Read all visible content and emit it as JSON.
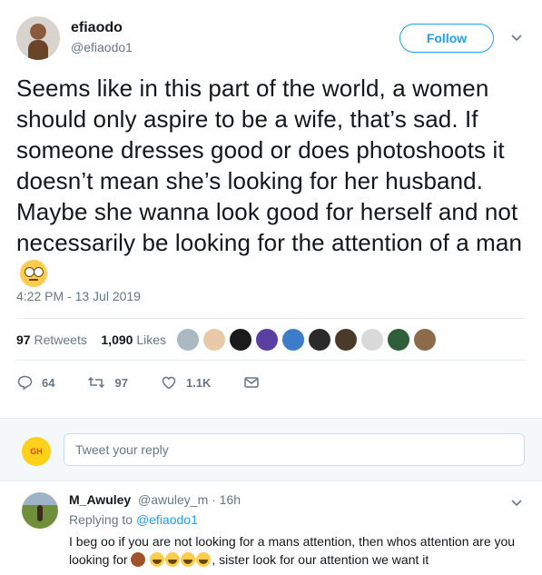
{
  "tweet": {
    "author_name": "efiaodo",
    "author_handle": "@efiaodo1",
    "follow_label": "Follow",
    "text": "Seems like in this part of the world, a women should only aspire to be a wife, that’s sad. If someone dresses good or does photoshoots it doesn’t mean she’s looking for her husband. Maybe she wanna look good for herself and not necessarily be looking for the attention of a man",
    "trailing_emoji": "face-with-rolling-eyes-emoji",
    "timestamp": "4:22 PM - 13 Jul 2019",
    "stats": {
      "retweets_count": "97",
      "retweets_label": "Retweets",
      "likes_count": "1,090",
      "likes_label": "Likes"
    },
    "liker_colors": [
      "#aab8c2",
      "#e8c9a8",
      "#1b1b1b",
      "#5a3ea0",
      "#3d7cc9",
      "#2b2b2b",
      "#4a3a2a",
      "#d9d9d9",
      "#2e5e3a",
      "#8b6b4a"
    ],
    "actions": {
      "replies": "64",
      "retweets": "97",
      "likes": "1.1K"
    }
  },
  "reply_box": {
    "placeholder": "Tweet your reply",
    "avatar_text": "GH"
  },
  "reply": {
    "name": "M_Awuley",
    "handle_time": "@awuley_m · 16h",
    "replying_prefix": "Replying to",
    "replying_handle": "@efiaodo1",
    "text_part1": "I beg oo if you are not looking for a mans attention, then whos attention are you looking for",
    "text_part2": ", sister look for our attention we want it"
  },
  "colors": {
    "accent": "#1da1f2",
    "muted": "#657786",
    "text": "#14171a"
  }
}
